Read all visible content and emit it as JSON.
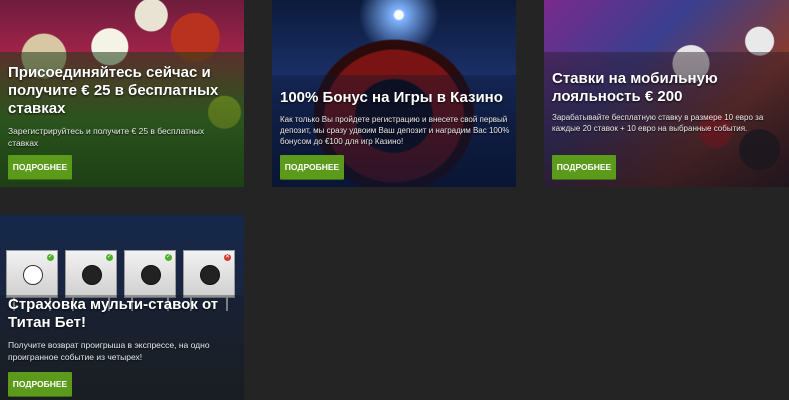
{
  "promos": [
    {
      "title": "Присоединяйтесь сейчас и получите € 25 в бесплатных ставках",
      "text": "Зарегистрируйтесь и получите € 25 в бесплатных ставках",
      "button": "ПОДРОБНЕЕ",
      "image": "sports-balls-image"
    },
    {
      "title": "100% Бонус на Игры в Казино",
      "text": "Как только Вы пройдете регистрацию и внесете свой первый депозит, мы сразу удвоим Ваш депозит и наградим Вас 100% бонусом до €100 для игр Казино!",
      "button": "ПОДРОБНЕЕ",
      "image": "roulette-wheel-image"
    },
    {
      "title": "Ставки на мобильную лояльность € 200",
      "text": "Зарабатывайте бесплатную ставку в размере 10 евро за каждые 20 ставок + 10 евро на выбранные события.",
      "button": "ПОДРОБНЕЕ",
      "image": "casino-chips-cards-image"
    },
    {
      "title": "Страховка мульти-ставок от Титан Бет!",
      "text": "Получите возврат проигрыша в экспрессе, на одно проигранное событие из четырех!",
      "button": "ПОДРОБНЕЕ",
      "image": "multi-bet-tiles-image"
    }
  ],
  "colors": {
    "page_bg": "#242424",
    "button_green": "#5c9a1b",
    "check_green": "#4caf2a",
    "cross_red": "#d23a2a"
  }
}
